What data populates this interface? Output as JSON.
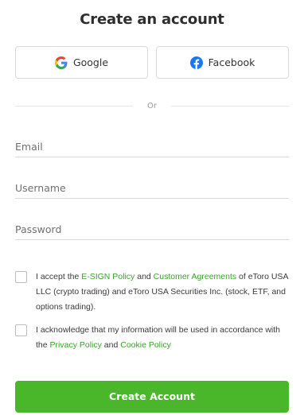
{
  "header": {
    "title": "Create an account"
  },
  "social": {
    "google_label": "Google",
    "facebook_label": "Facebook",
    "google_icon": "google-icon",
    "facebook_icon": "facebook-icon"
  },
  "divider": {
    "text": "Or"
  },
  "form": {
    "email_placeholder": "Email",
    "username_placeholder": "Username",
    "password_placeholder": "Password"
  },
  "consent": {
    "esign": {
      "prefix": "I accept the ",
      "esign_link": "E-SIGN Policy",
      "and1": " and ",
      "agreements_link": "Customer Agreements",
      "suffix": " of eToro USA LLC (crypto trading) and eToro USA Securities Inc. (stock, ETF, and options trading)."
    },
    "ack": {
      "prefix": "I acknowledge that my information will be used in accordance with the ",
      "privacy_link": "Privacy Policy",
      "and": " and ",
      "cookie_link": "Cookie Policy"
    }
  },
  "actions": {
    "create_label": "Create Account"
  },
  "colors": {
    "accent": "#4ab72b",
    "link": "#3aa22c",
    "facebook": "#1877f2"
  }
}
